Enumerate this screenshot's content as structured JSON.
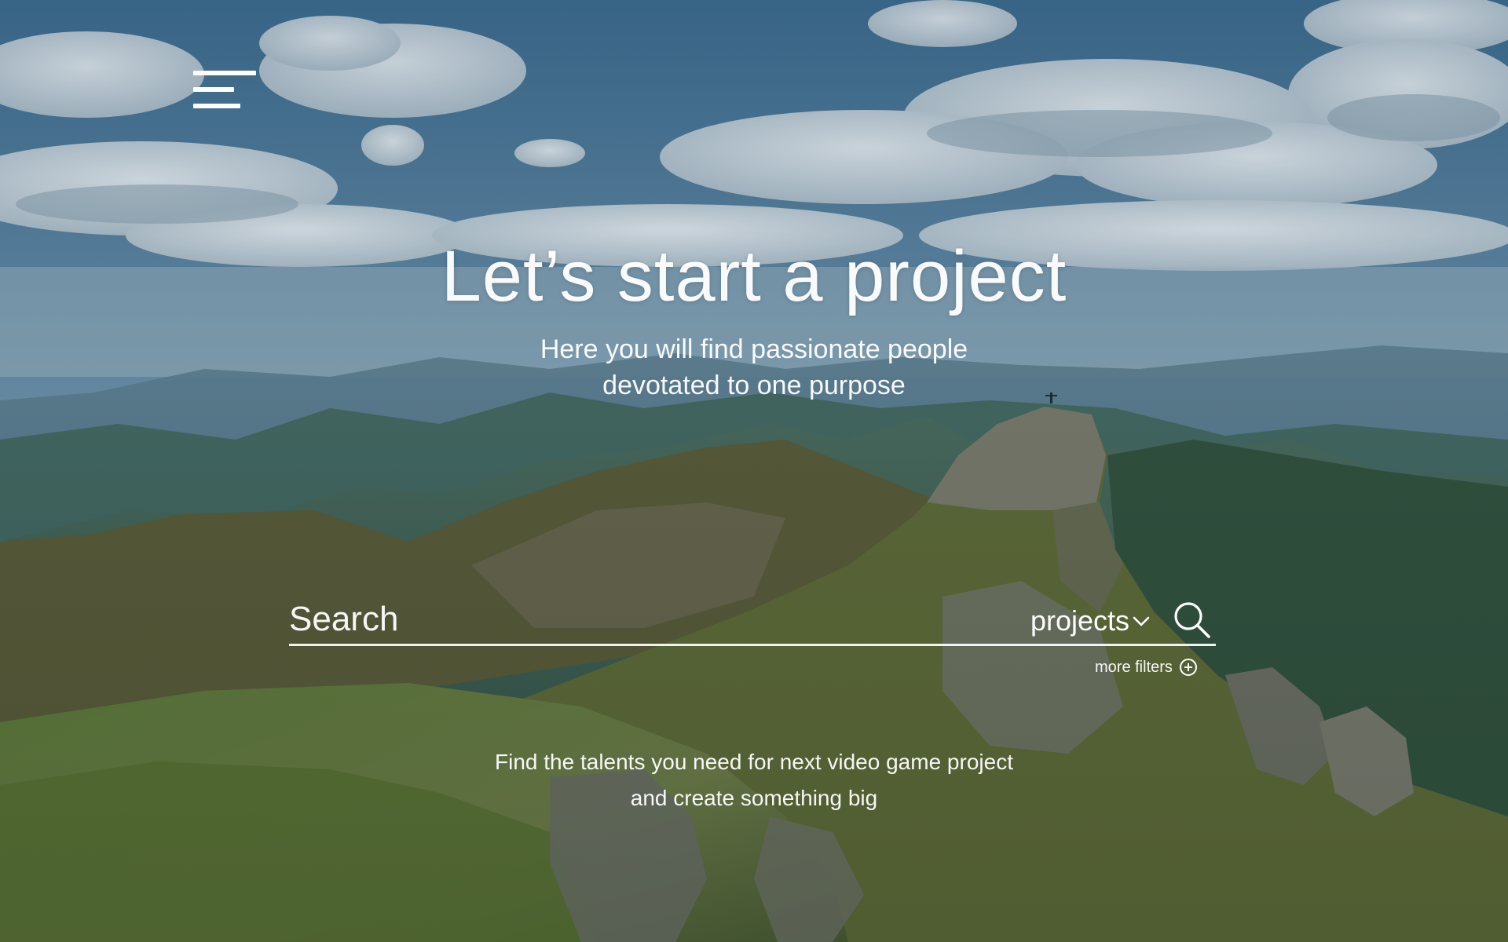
{
  "menu": {
    "icon": "menu-icon"
  },
  "hero": {
    "title": "Let’s start a project",
    "subtitle_line1": "Here you will find passionate people",
    "subtitle_line2": "devotated to one purpose"
  },
  "search": {
    "placeholder": "Search",
    "value": "",
    "category_selected": "projects",
    "category_icon": "chevron-down-icon",
    "submit_icon": "search-icon",
    "more_filters_label": "more filters",
    "more_filters_icon": "plus-circle-icon"
  },
  "tagline": {
    "line1": "Find the talents you need for next video game project",
    "line2": "and create something big"
  },
  "colors": {
    "text": "#ffffff",
    "sky_top": "#3e6f93",
    "mountain_green": "#4f6a3a"
  }
}
